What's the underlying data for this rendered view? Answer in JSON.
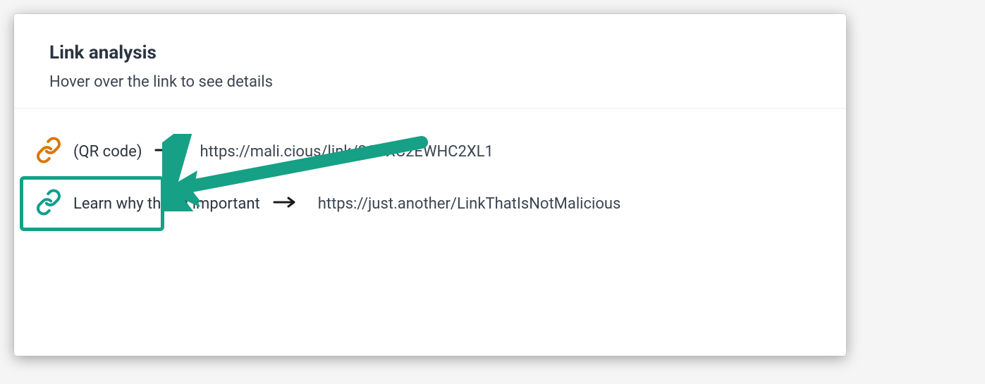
{
  "header": {
    "title": "Link analysis",
    "subtitle": "Hover over the link to see details"
  },
  "links": [
    {
      "label": "(QR code)",
      "url": "https://mali.cious/link/3OJXC2EWHC2XL1",
      "icon_color": "#d97706",
      "icon_name": "link-icon"
    },
    {
      "label": "Learn why this is important",
      "url": "https://just.another/LinkThatIsNotMalicious",
      "icon_color": "#0f9d8c",
      "icon_name": "link-icon"
    }
  ],
  "colors": {
    "highlight": "#16a085",
    "text_primary": "#2b3440",
    "text_secondary": "#3b4552"
  }
}
